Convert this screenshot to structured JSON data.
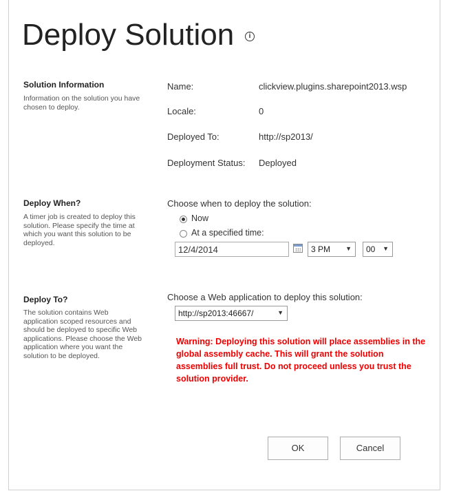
{
  "page": {
    "title": "Deploy Solution"
  },
  "solution_info": {
    "title": "Solution Information",
    "desc": "Information on the solution you have chosen to deploy.",
    "name_label": "Name:",
    "name_value": "clickview.plugins.sharepoint2013.wsp",
    "locale_label": "Locale:",
    "locale_value": "0",
    "deployed_to_label": "Deployed To:",
    "deployed_to_value": "http://sp2013/",
    "status_label": "Deployment Status:",
    "status_value": "Deployed"
  },
  "deploy_when": {
    "title": "Deploy When?",
    "desc": "A timer job is created to deploy this solution. Please specify the time at which you want this solution to be deployed.",
    "prompt": "Choose when to deploy the solution:",
    "option_now": "Now",
    "option_specified": "At a specified time:",
    "selected": "now",
    "date_value": "12/4/2014",
    "hour_value": "3 PM",
    "minute_value": "00"
  },
  "deploy_to": {
    "title": "Deploy To?",
    "desc": "The solution contains Web application scoped resources and should be deployed to specific Web applications. Please choose the Web application where you want the solution to be deployed.",
    "prompt": "Choose a Web application to deploy this solution:",
    "web_app_value": "http://sp2013:46667/",
    "warning": "Warning: Deploying this solution will place assemblies in the global assembly cache. This will grant the solution assemblies full trust. Do not proceed unless you trust the solution provider."
  },
  "buttons": {
    "ok": "OK",
    "cancel": "Cancel"
  },
  "colors": {
    "warning": "#ee0000",
    "text": "#333333"
  }
}
